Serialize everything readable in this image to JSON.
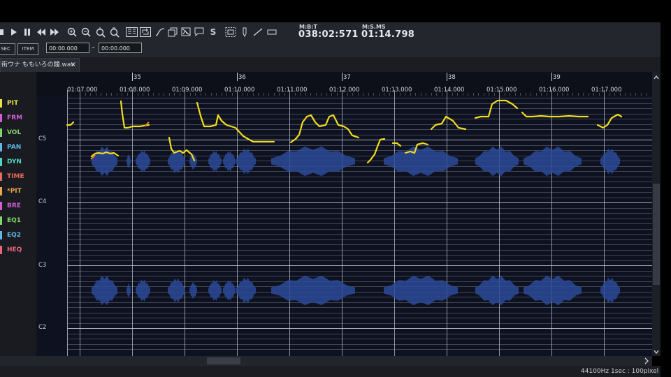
{
  "toolbar": {
    "buttons": [
      "stop-icon",
      "play-icon",
      "pause-icon",
      "rewind-icon",
      "fast-forward-icon",
      "zoom-in-icon",
      "zoom-out-icon",
      "vertical-zoom-in-icon",
      "vertical-zoom-out-icon",
      "book-icon",
      "loop-icon",
      "curve-icon",
      "copy-icon",
      "image-icon",
      "picture-icon",
      "comment-icon",
      "s-icon",
      "select-box-icon",
      "pin-icon",
      "line-icon",
      "rect-icon"
    ],
    "s_label": "S",
    "mbt_label": "M:B:T",
    "mbt_value": "038:02:571",
    "msms_label": "M:S.MS",
    "msms_value": "01:14.798"
  },
  "row2": {
    "sec_label": "SEC",
    "item_label": "ITEM",
    "start_time": "00:00.000",
    "range_dash": "–",
    "end_time": "00:00.000"
  },
  "tab": {
    "title": "街ウナ ももいろの鐘.wav",
    "close": "×"
  },
  "params": [
    {
      "label": "PIT",
      "color": "#e6e24a"
    },
    {
      "label": "FRM",
      "color": "#d45cd4"
    },
    {
      "label": "VOL",
      "color": "#7fd66a"
    },
    {
      "label": "PAN",
      "color": "#5fb6e8"
    },
    {
      "label": "DYN",
      "color": "#4fd6c2"
    },
    {
      "label": "TIME",
      "color": "#e86a5a"
    },
    {
      "label": "*PIT",
      "color": "#e8a84a"
    },
    {
      "label": "BRE",
      "color": "#d45cd4"
    },
    {
      "label": "EQ1",
      "color": "#7fd66a"
    },
    {
      "label": "EQ2",
      "color": "#5fb6e8"
    },
    {
      "label": "HEQ",
      "color": "#e86a7a"
    }
  ],
  "ruler": {
    "measures": [
      "35",
      "36",
      "37",
      "38",
      "39"
    ],
    "times": [
      "01:07.000",
      "01:08.000",
      "01:09.000",
      "01:10.000",
      "01:11.000",
      "01:12.000",
      "01:13.000",
      "01:14.000",
      "01:15.000",
      "01:16.000",
      "01:17.000"
    ]
  },
  "notes": [
    "C5",
    "C4",
    "C3",
    "C2"
  ],
  "status": {
    "samplerate": "44100Hz",
    "scale": "1sec : 100pixel"
  },
  "colors": {
    "pitch_curve": "#f2dc1e",
    "waveform": "#2c4a9a",
    "grid": "#b9bfca"
  }
}
